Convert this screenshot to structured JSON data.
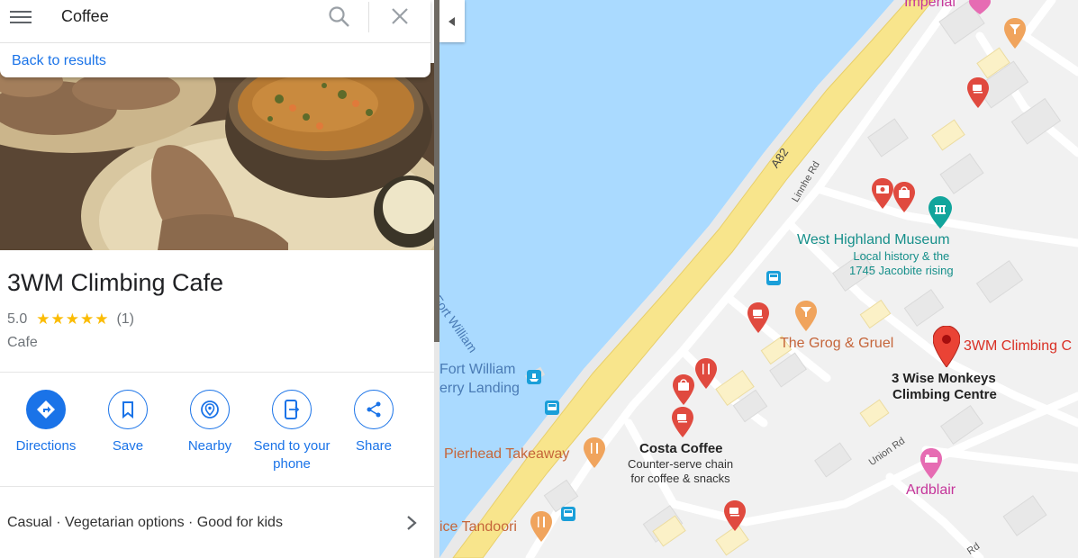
{
  "search": {
    "query": "Coffee"
  },
  "back_link": "Back to results",
  "place": {
    "name": "3WM Climbing Cafe",
    "rating": "5.0",
    "stars": "★★★★★",
    "review_count": "(1)",
    "category": "Cafe",
    "rating_value": 5,
    "rating_max": 5
  },
  "actions": [
    {
      "label": "Directions",
      "icon": "directions-icon"
    },
    {
      "label": "Save",
      "icon": "bookmark-icon"
    },
    {
      "label": "Nearby",
      "icon": "nearby-icon"
    },
    {
      "label": "Send to your phone",
      "icon": "send-to-phone-icon"
    },
    {
      "label": "Share",
      "icon": "share-icon"
    }
  ],
  "attributes": "Casual · Vegetarian options · Good for kids",
  "map": {
    "labels": {
      "imperial": "Imperial",
      "road_a82": "A82",
      "linnhe_rd": "Linnhe Rd",
      "west_highland_museum": "West Highland Museum",
      "museum_sub": "Local history & the\n1745 Jacobite rising",
      "fort_william_road": "- Fort William",
      "ferry_landing_1": "Fort William",
      "ferry_landing_2": "erry Landing",
      "grog_gruel": "The Grog & Gruel",
      "three_wm": "3WM Climbing C",
      "three_wise": "3 Wise Monkeys",
      "climbing_centre": "Climbing Centre",
      "pierhead": "Pierhead Takeaway",
      "costa": "Costa Coffee",
      "costa_sub": "Counter-serve chain\nfor coffee & snacks",
      "union_rd": "Union Rd",
      "ardblair": "Ardblair",
      "tandoori": "ice Tandoori",
      "rd_bottom": "Rd"
    }
  },
  "colors": {
    "accent": "#1a73e8",
    "water": "#aadaff",
    "road_major": "#f8e58c",
    "pin_red": "#ea4335",
    "star": "#fbbc04"
  }
}
